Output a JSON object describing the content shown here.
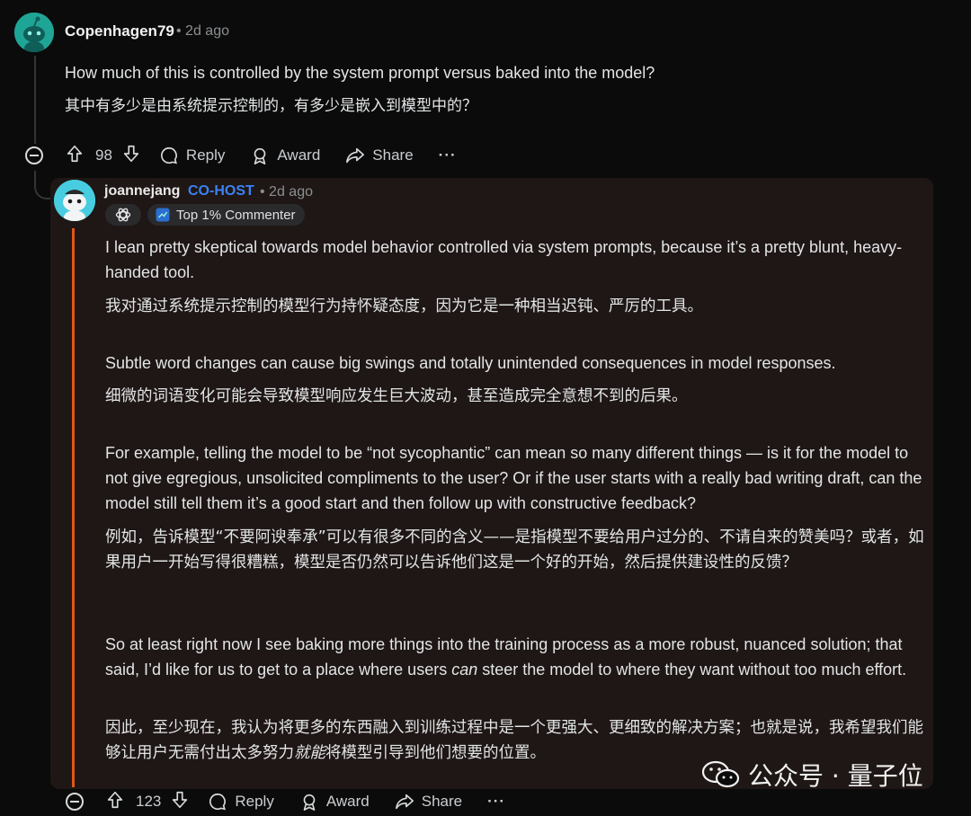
{
  "comment": {
    "username": "Copenhagen79",
    "time": "• 2d ago",
    "paragraphs": [
      "How much of this is controlled by the system prompt versus baked into the model?",
      "其中有多少是由系统提示控制的，有多少是嵌入到模型中的？"
    ],
    "votes": "98",
    "actions": {
      "reply": "Reply",
      "award": "Award",
      "share": "Share",
      "more": "···"
    }
  },
  "reply": {
    "username": "joannejang",
    "role_badge": "CO-HOST",
    "time": "• 2d ago",
    "flair": "Top 1% Commenter",
    "paragraphs": [
      "I lean pretty skeptical towards model behavior controlled via system prompts, because it’s a pretty blunt, heavy-handed tool.",
      "我对通过系统提示控制的模型行为持怀疑态度，因为它是一种相当迟钝、严厉的工具。",
      "Subtle word changes can cause big swings and totally unintended consequences in model responses.",
      "细微的词语变化可能会导致模型响应发生巨大波动，甚至造成完全意想不到的后果。",
      "For example, telling the model to be “not sycophantic” can mean so many different things — is it for the model to not give egregious, unsolicited compliments to the user? Or if the user starts with a really bad writing draft, can the model still tell them it’s a good start and then follow up with constructive feedback?",
      "例如，告诉模型“不要阿谀奉承”可以有很多不同的含义——是指模型不要给用户过分的、不请自来的赞美吗？或者，如果用户一开始写得很糟糕，模型是否仍然可以告诉他们这是一个好的开始，然后提供建设性的反馈？"
    ],
    "p7_before": "So at least right now I see baking more things into the training process as a more robust, nuanced solution; that said, I’d like for us to get to a place where users ",
    "p7_em": "can",
    "p7_after": " steer the model to where they want without too much effort.",
    "p8_before": "因此，至少现在，我认为将更多的东西融入到训练过程中是一个更强大、更细致的解决方案；也就是说，我希望我们能够让用户无需付出太多努力",
    "p8_em": "就能",
    "p8_after": "将模型引导到他们想要的位置。",
    "votes": "123",
    "actions": {
      "reply": "Reply",
      "award": "Award",
      "share": "Share",
      "more": "···"
    }
  },
  "watermark": {
    "text": "公众号 · 量子位",
    "icon": "wechat-icon"
  }
}
